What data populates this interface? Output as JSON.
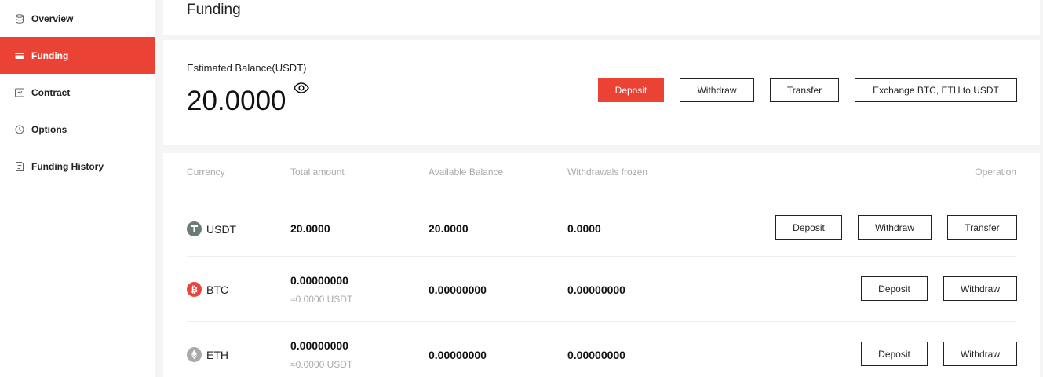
{
  "sidebar": {
    "items": [
      {
        "label": "Overview",
        "icon": "database-icon"
      },
      {
        "label": "Funding",
        "icon": "wallet-icon",
        "active": true
      },
      {
        "label": "Contract",
        "icon": "contract-icon"
      },
      {
        "label": "Options",
        "icon": "clock-icon"
      },
      {
        "label": "Funding History",
        "icon": "document-icon"
      }
    ]
  },
  "page": {
    "title": "Funding"
  },
  "balance": {
    "label": "Estimated Balance(USDT)",
    "value": "20.0000",
    "actions": {
      "deposit": "Deposit",
      "withdraw": "Withdraw",
      "transfer": "Transfer",
      "exchange": "Exchange BTC, ETH to USDT"
    }
  },
  "table": {
    "headers": {
      "currency": "Currency",
      "total": "Total amount",
      "available": "Available Balance",
      "frozen": "Withdrawals frozen",
      "operation": "Operation"
    },
    "rows": [
      {
        "currency": "USDT",
        "total": "20.0000",
        "total_sub": "",
        "available": "20.0000",
        "frozen": "0.0000",
        "ops": [
          "Deposit",
          "Withdraw",
          "Transfer"
        ]
      },
      {
        "currency": "BTC",
        "total": "0.00000000",
        "total_sub": "≈0.0000 USDT",
        "available": "0.00000000",
        "frozen": "0.00000000",
        "ops": [
          "Deposit",
          "Withdraw"
        ]
      },
      {
        "currency": "ETH",
        "total": "0.00000000",
        "total_sub": "≈0.0000 USDT",
        "available": "0.00000000",
        "frozen": "0.00000000",
        "ops": [
          "Deposit",
          "Withdraw"
        ]
      }
    ]
  },
  "colors": {
    "accent": "#ea4336",
    "usdt": "#6b7b78",
    "btc": "#e8453c",
    "eth": "#a9a9a9"
  }
}
